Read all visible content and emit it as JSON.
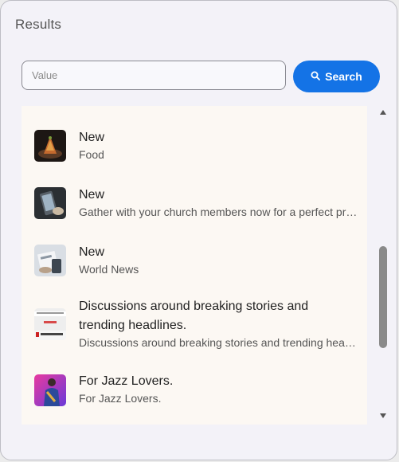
{
  "dialog": {
    "title": "Results"
  },
  "search": {
    "placeholder": "Value",
    "value": "",
    "button_label": "Search"
  },
  "results": [
    {
      "title": "New",
      "subtitle": "Food",
      "thumb_icon": "food-thumbnail"
    },
    {
      "title": "New",
      "subtitle": "Gather with your church members now for a perfect pr…",
      "thumb_icon": "phone-thumbnail"
    },
    {
      "title": "New",
      "subtitle": "World News",
      "thumb_icon": "news-thumbnail"
    },
    {
      "title": "Discussions around breaking stories and trending headlines.",
      "subtitle": "Discussions around breaking stories and trending hea…",
      "thumb_icon": "newspaper-thumbnail"
    },
    {
      "title": "For Jazz Lovers.",
      "subtitle": "For Jazz Lovers.",
      "thumb_icon": "jazz-thumbnail"
    }
  ],
  "colors": {
    "accent": "#1473e6",
    "list_bg": "#fcf8f3",
    "dialog_bg": "#f3f2f8"
  }
}
